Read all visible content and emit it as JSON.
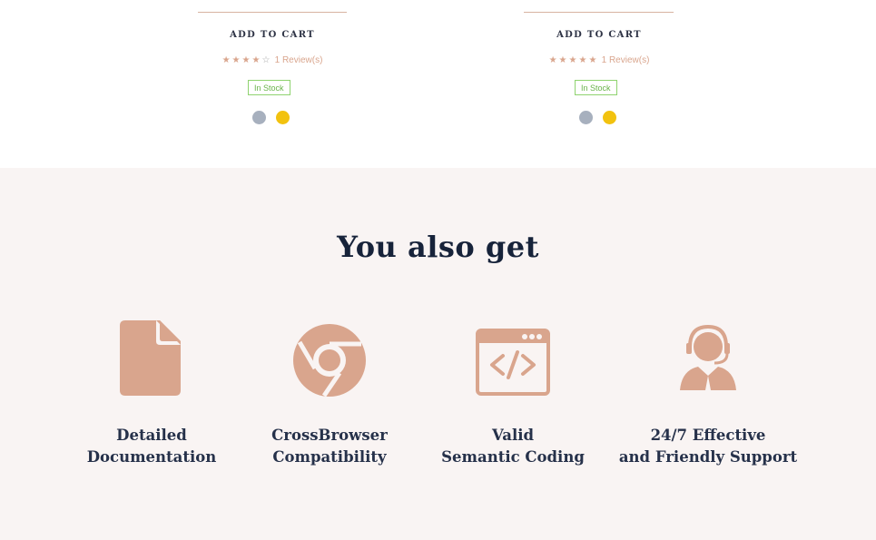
{
  "products": [
    {
      "add_to_cart": "ADD TO CART",
      "stars_filled": "★★★★",
      "stars_empty": "☆",
      "rating": 4,
      "reviews": "1 Review(s)",
      "stock": "In Stock",
      "swatches": [
        "#a7b0be",
        "#f2c20f"
      ]
    },
    {
      "add_to_cart": "ADD TO CART",
      "stars_filled": "★★★★★",
      "stars_empty": "",
      "rating": 5,
      "reviews": "1 Review(s)",
      "stock": "In Stock",
      "swatches": [
        "#a7b0be",
        "#f2c20f"
      ]
    }
  ],
  "section": {
    "title": "You also get",
    "features": [
      {
        "icon": "document-icon",
        "line1": "Detailed",
        "line2": "Documentation"
      },
      {
        "icon": "chrome-icon",
        "line1": "CrossBrowser",
        "line2": "Compatibility"
      },
      {
        "icon": "code-window-icon",
        "line1": "Valid",
        "line2": "Semantic Coding"
      },
      {
        "icon": "headset-support-icon",
        "line1": "24/7 Effective",
        "line2": "and Friendly Support"
      }
    ]
  },
  "colors": {
    "accent": "#d9a58d",
    "heading": "#17233a",
    "band_bg": "#f9f4f3",
    "stock_green": "#69b34a"
  }
}
